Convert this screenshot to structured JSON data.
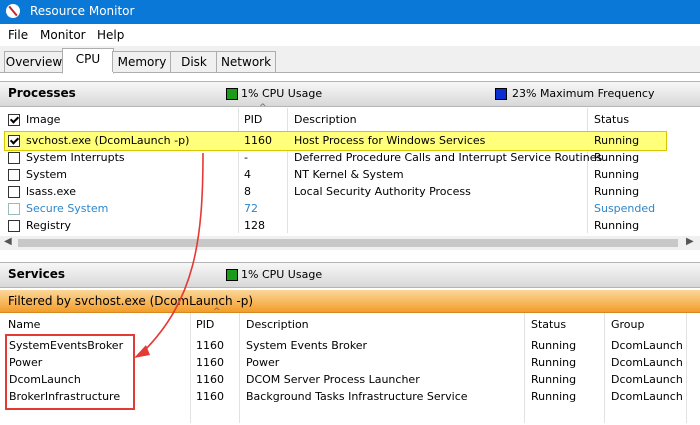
{
  "window": {
    "title": "Resource Monitor",
    "icon": "resource-monitor-icon"
  },
  "menu": [
    "File",
    "Monitor",
    "Help"
  ],
  "tabs": [
    "Overview",
    "CPU",
    "Memory",
    "Disk",
    "Network"
  ],
  "active_tab": "CPU",
  "processes": {
    "title": "Processes",
    "cpu_usage": "1% CPU Usage",
    "max_frequency": "23% Maximum Frequency",
    "columns": [
      "Image",
      "PID",
      "Description",
      "Status"
    ],
    "rows": [
      {
        "image": "svchost.exe (DcomLaunch -p)",
        "pid": "1160",
        "description": "Host Process for Windows Services",
        "status": "Running",
        "checked": true,
        "highlighted": true
      },
      {
        "image": "System Interrupts",
        "pid": "-",
        "description": "Deferred Procedure Calls and Interrupt Service Routines",
        "status": "Running",
        "checked": false
      },
      {
        "image": "System",
        "pid": "4",
        "description": "NT Kernel & System",
        "status": "Running",
        "checked": false
      },
      {
        "image": "lsass.exe",
        "pid": "8",
        "description": "Local Security Authority Process",
        "status": "Running",
        "checked": false
      },
      {
        "image": "Secure System",
        "pid": "72",
        "description": "",
        "status": "Suspended",
        "checked": false,
        "suspended": true
      },
      {
        "image": "Registry",
        "pid": "128",
        "description": "",
        "status": "Running",
        "checked": false
      }
    ]
  },
  "services": {
    "title": "Services",
    "cpu_usage": "1% CPU Usage",
    "filter_text": "Filtered by svchost.exe (DcomLaunch -p)",
    "columns": [
      "Name",
      "PID",
      "Description",
      "Status",
      "Group"
    ],
    "rows": [
      {
        "name": "SystemEventsBroker",
        "pid": "1160",
        "description": "System Events Broker",
        "status": "Running",
        "group": "DcomLaunch"
      },
      {
        "name": "Power",
        "pid": "1160",
        "description": "Power",
        "status": "Running",
        "group": "DcomLaunch"
      },
      {
        "name": "DcomLaunch",
        "pid": "1160",
        "description": "DCOM Server Process Launcher",
        "status": "Running",
        "group": "DcomLaunch"
      },
      {
        "name": "BrokerInfrastructure",
        "pid": "1160",
        "description": "Background Tasks Infrastructure Service",
        "status": "Running",
        "group": "DcomLaunch"
      }
    ]
  },
  "colors": {
    "title_bar": "#0a78d7",
    "highlight": "#ffff7a",
    "filter_bar": "#f39d2a",
    "annotation": "#e53935",
    "suspended_text": "#2e86c9"
  }
}
